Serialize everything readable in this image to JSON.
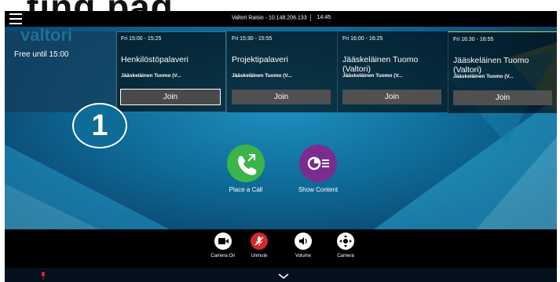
{
  "status": {
    "system_name": "Valtori Raisio - 10.148.206.133",
    "time": "14:45"
  },
  "background_logo": "valtori",
  "free_tile": {
    "text": "Free until 15:00"
  },
  "meetings": [
    {
      "time": "Fri 15:00 - 15:25",
      "title": "Henkilöstöpalaveri",
      "organizer": "Jääskeläinen Tuomo (V...",
      "join_label": "Join"
    },
    {
      "time": "Fri 15:30 - 15:55",
      "title": "Projektipalaveri",
      "organizer": "Jääskeläinen Tuomo (V...",
      "join_label": "Join"
    },
    {
      "time": "Fri 16:00 - 16:25",
      "title": "Jääskeläinen Tuomo (Valtori)",
      "organizer": "Jääskeläinen Tuomo (V...",
      "join_label": "Join"
    },
    {
      "time": "Fri 16:30 - 16:55",
      "title": "Jääskeläinen Tuomo (Valtori)",
      "organizer": "Jääskeläinen Tuomo (V...",
      "join_label": "Join"
    }
  ],
  "callout_badge": "1",
  "actions": {
    "place_call": {
      "label": "Place a Call",
      "icon": "phone-icon",
      "color": "#3bb54a"
    },
    "show_content": {
      "label": "Show Content",
      "icon": "share-content-icon",
      "color": "#7b2d8e"
    }
  },
  "controls": [
    {
      "label": "Camera On",
      "icon": "camera-icon"
    },
    {
      "label": "Unmute",
      "icon": "mic-muted-icon",
      "color": "#d8262b"
    },
    {
      "label": "Volume",
      "icon": "speaker-icon"
    },
    {
      "label": "Camera",
      "icon": "camera-control-icon"
    }
  ],
  "colors": {
    "accent_yellow": "#d8c64a",
    "stage_blue": "#0f6b98"
  }
}
